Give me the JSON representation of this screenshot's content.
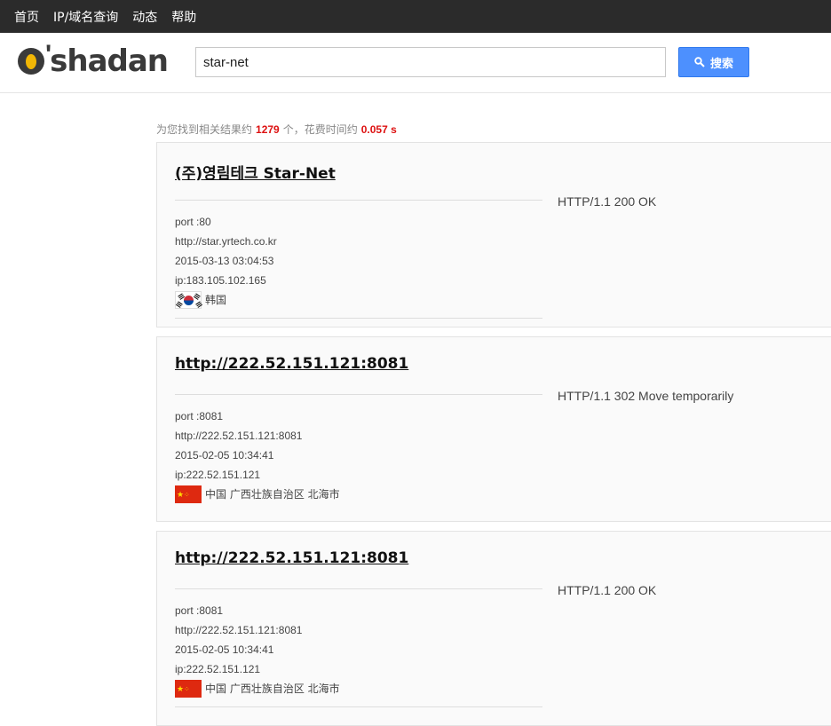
{
  "nav": {
    "items": [
      "首页",
      "IP/域名查询",
      "动态",
      "帮助"
    ]
  },
  "logo": {
    "text": "shadan",
    "apostrophe": "'"
  },
  "search": {
    "value": "star-net",
    "button_label": "搜索"
  },
  "summary": {
    "prefix": "为您找到相关结果约",
    "count": "1279",
    "mid": "个，花费时间约",
    "time": "0.057 s"
  },
  "results": [
    {
      "title": "(주)영림테크 Star-Net",
      "port": "port :80",
      "url": "http://star.yrtech.co.kr",
      "date": "2015-03-13 03:04:53",
      "ip": "ip:183.105.102.165",
      "location": "韩国",
      "flag": "flag-kr-icon",
      "status": "HTTP/1.1 200 OK"
    },
    {
      "title": "http://222.52.151.121:8081",
      "port": "port :8081",
      "url": "http://222.52.151.121:8081",
      "date": "2015-02-05 10:34:41",
      "ip": "ip:222.52.151.121",
      "location": "中国 广西壮族自治区 北海市",
      "flag": "flag-cn-icon",
      "status": "HTTP/1.1 302 Move temporarily"
    },
    {
      "title": "http://222.52.151.121:8081",
      "port": "port :8081",
      "url": "http://222.52.151.121:8081",
      "date": "2015-02-05 10:34:41",
      "ip": "ip:222.52.151.121",
      "location": "中国 广西壮族自治区 北海市",
      "flag": "flag-cn-icon",
      "status": "HTTP/1.1 200 OK"
    }
  ],
  "colors": {
    "topbar": "#2b2b2b",
    "button": "#4d90fe",
    "highlight": "#dd1111",
    "logo_accent": "#f2b705"
  }
}
